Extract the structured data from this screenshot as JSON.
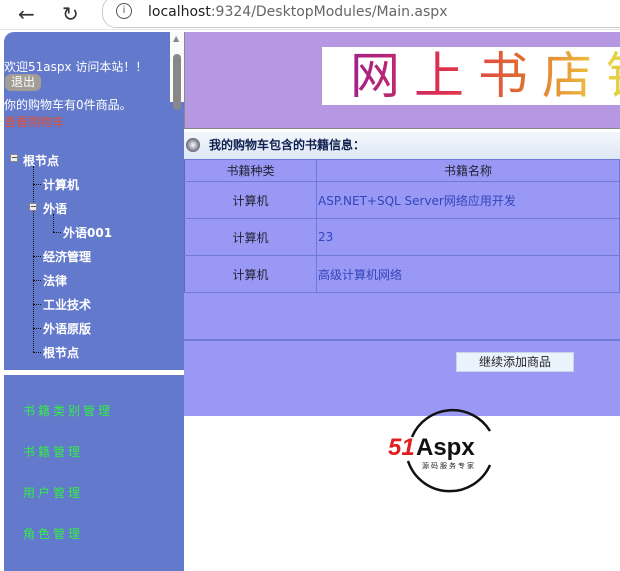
{
  "browser": {
    "back_icon": "arrow-left-icon",
    "reload_icon": "reload-icon",
    "url_host": "localhost",
    "url_rest": ":9324/DesktopModules/Main.aspx"
  },
  "sidebar": {
    "welcome": "欢迎51aspx 访问本站！！",
    "logout": "退出",
    "cart_count": "你的购物车有0件商品。",
    "view_cart": "查看购物车",
    "tree": [
      {
        "label": "根节点"
      },
      {
        "label": "计算机"
      },
      {
        "label": "外语"
      },
      {
        "label": "外语001"
      },
      {
        "label": "经济管理"
      },
      {
        "label": "法律"
      },
      {
        "label": "工业技术"
      },
      {
        "label": "外语原版"
      },
      {
        "label": "根节点"
      }
    ],
    "menu": [
      "书籍类别管理",
      "书籍管理",
      "用户管理",
      "角色管理"
    ]
  },
  "banner": {
    "title": "网上书店铺"
  },
  "cart": {
    "heading": "我的购物车包含的书籍信息：",
    "columns": [
      "书籍种类",
      "书籍名称"
    ],
    "rows": [
      [
        "计算机",
        "ASP.NET+SQL Server网络应用开发"
      ],
      [
        "计算机",
        "23"
      ],
      [
        "计算机",
        "高级计算机网络"
      ]
    ],
    "continue_button": "继续添加商品"
  },
  "footer": {
    "logo_text": "51Aspx",
    "logo_sub": "源码服务专家"
  },
  "colors": {
    "sidebar": "#6379cc",
    "table": "#9999f5",
    "banner": "#b698e2",
    "menu_text": "#33ee44"
  }
}
